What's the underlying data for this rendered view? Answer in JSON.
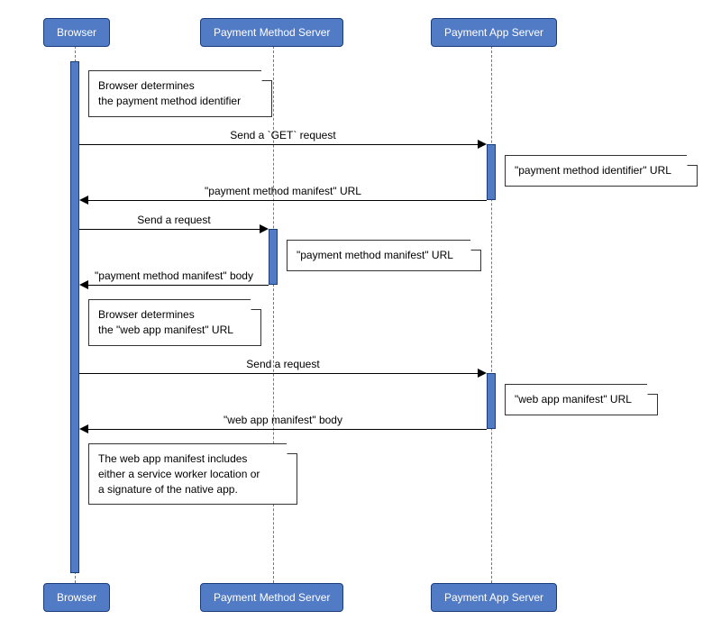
{
  "participants": {
    "browser": "Browser",
    "pms": "Payment Method Server",
    "pas": "Payment App Server"
  },
  "notes": {
    "n1_l1": "Browser determines",
    "n1_l2": "the payment method identifier",
    "n2": "\"payment method identifier\" URL",
    "n3": "\"payment method manifest\" URL",
    "n4_l1": "Browser determines",
    "n4_l2": "the \"web app manifest\" URL",
    "n5": "\"web app manifest\" URL",
    "n6_l1": "The web app manifest includes",
    "n6_l2": "either a service worker location or",
    "n6_l3": "a signature of the native app."
  },
  "messages": {
    "m1": "Send a `GET` request",
    "m2": "\"payment method manifest\" URL",
    "m3": "Send a request",
    "m4": "\"payment method manifest\" body",
    "m5": "Send a request",
    "m6": "\"web app manifest\" body"
  }
}
